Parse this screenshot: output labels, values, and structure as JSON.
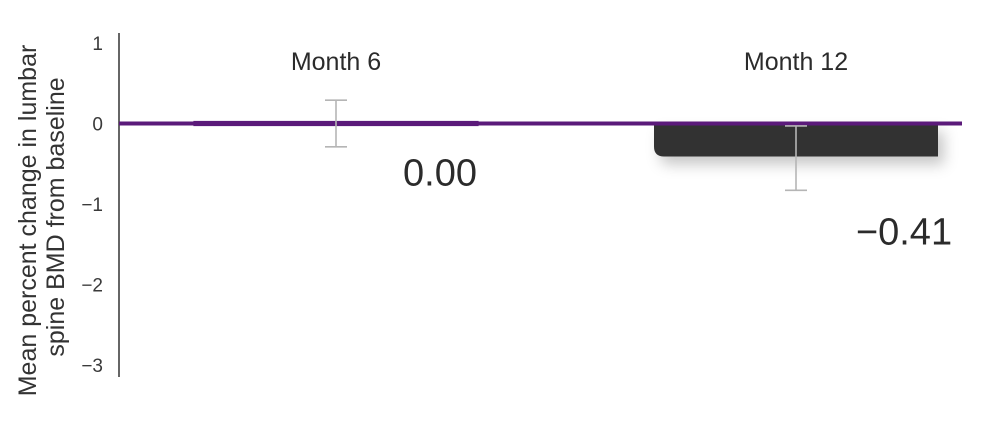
{
  "chart_data": {
    "type": "bar",
    "title": "",
    "xlabel": "",
    "ylabel_lines": [
      "Mean percent change in lumbar",
      "spine BMD from baseline"
    ],
    "ylim": [
      -3,
      1
    ],
    "yticks": [
      1,
      0,
      -1,
      -2,
      -3
    ],
    "ytick_labels": [
      "1",
      "0",
      "−1",
      "−2",
      "−3"
    ],
    "grid": false,
    "categories": [
      "Month 6",
      "Month 12"
    ],
    "values": [
      0.0,
      -0.41
    ],
    "value_labels": [
      "0.00",
      "−0.41"
    ],
    "error_low": [
      -0.29,
      -0.83
    ],
    "error_high": [
      0.29,
      -0.03
    ],
    "colors": {
      "zero_line": "#5b1a7a",
      "bar_month12": "#333333",
      "bar_month6_outline": "#5b1a7a",
      "error_bar": "#b5b5b5",
      "axis": "#333333"
    }
  }
}
